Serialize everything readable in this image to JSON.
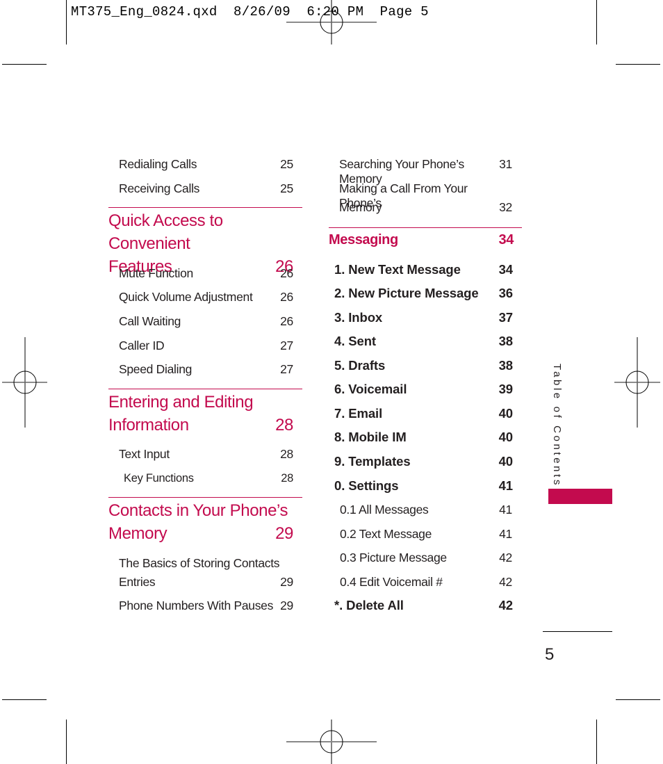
{
  "slug": "MT375_Eng_0824.qxd  8/26/09  6:20 PM  Page 5",
  "colors": {
    "accent": "#c30b4e",
    "text": "#231f20"
  },
  "left_column": {
    "top_entries": [
      {
        "label": "Redialing Calls",
        "page": "25"
      },
      {
        "label": "Receiving Calls",
        "page": "25"
      }
    ],
    "sections": [
      {
        "title_line1": "Quick Access to Convenient",
        "title_line2": "Features",
        "page": "26",
        "entries": [
          {
            "label": "Mute Function",
            "page": "26"
          },
          {
            "label": "Quick Volume Adjustment",
            "page": "26"
          },
          {
            "label": "Call Waiting",
            "page": "26"
          },
          {
            "label": "Caller ID",
            "page": "27"
          },
          {
            "label": "Speed Dialing",
            "page": "27"
          }
        ]
      },
      {
        "title_line1": "Entering and Editing",
        "title_line2": "Information",
        "page": "28",
        "entries": [
          {
            "label": "Text Input",
            "page": "28"
          },
          {
            "label": "Key Functions",
            "page": "28"
          }
        ]
      },
      {
        "title_line1": "Contacts in Your Phone’s",
        "title_line2": "Memory",
        "page": "29",
        "entries": [
          {
            "label_line1": "The Basics of Storing Contacts",
            "label": "Entries",
            "page": "29"
          },
          {
            "label": "Phone Numbers With Pauses",
            "page": "29"
          }
        ]
      }
    ]
  },
  "right_column": {
    "top_entries": [
      {
        "label": "Searching Your Phone’s Memory",
        "page": "31"
      },
      {
        "label_line1": "Making a Call From Your Phone’s",
        "label": "Memory",
        "page": "32"
      }
    ],
    "section": {
      "title": "Messaging",
      "page": "34",
      "entries": [
        {
          "label": "1. New Text Message",
          "page": "34"
        },
        {
          "label": "2. New Picture Message",
          "page": "36"
        },
        {
          "label": "3. Inbox",
          "page": "37"
        },
        {
          "label": "4. Sent",
          "page": "38"
        },
        {
          "label": "5. Drafts",
          "page": "38"
        },
        {
          "label": "6. Voicemail",
          "page": "39"
        },
        {
          "label": "7. Email",
          "page": "40"
        },
        {
          "label": "8. Mobile IM",
          "page": "40"
        },
        {
          "label": "9. Templates",
          "page": "40"
        },
        {
          "label": "0. Settings",
          "page": "41"
        },
        {
          "label": "0.1 All Messages",
          "page": "41"
        },
        {
          "label": "0.2 Text Message",
          "page": "41"
        },
        {
          "label": "0.3 Picture Message",
          "page": "42"
        },
        {
          "label": "0.4 Edit Voicemail #",
          "page": "42"
        },
        {
          "label": "*. Delete All",
          "page": "42"
        }
      ]
    }
  },
  "side_tab": {
    "label": "Table of Contents"
  },
  "folio": "5"
}
